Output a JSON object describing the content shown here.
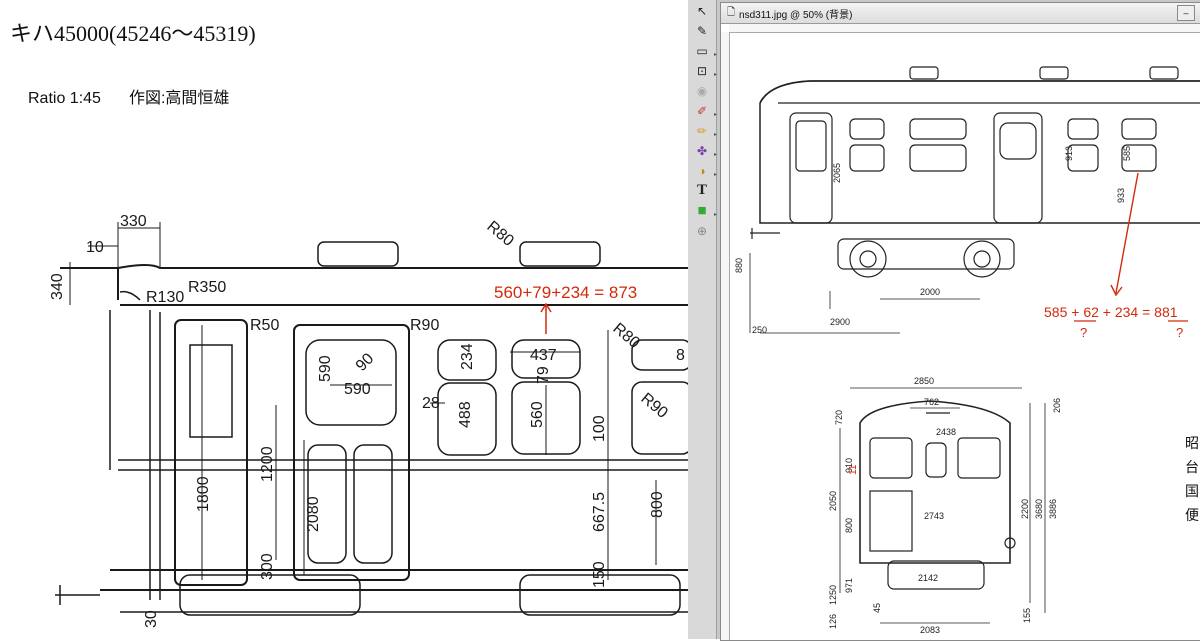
{
  "left_drawing": {
    "title": "キハ45000(45246〜45319)",
    "ratio": "Ratio 1:45",
    "drawn_by": "作図:高間恒雄",
    "dims": {
      "d330": "330",
      "d10": "10",
      "d340": "340",
      "r80": "R80",
      "r130": "R130",
      "r350": "R350",
      "r50": "R50",
      "r90": "R90",
      "r80b": "R80",
      "r90b": "R90",
      "d590a": "590",
      "d590b": "590",
      "d234": "234",
      "d437": "437",
      "d79": "79",
      "d28": "28",
      "d488": "488",
      "d560": "560",
      "d1800": "1800",
      "d1200": "1200",
      "d2080": "2080",
      "d100": "100",
      "d6675": "667.5",
      "d800": "800",
      "d300": "300",
      "d150": "150",
      "d8": "8",
      "d30": "30",
      "d90": "90"
    },
    "annotation": "560+79+234 = 873"
  },
  "app": {
    "window_title": "nsd311.jpg @ 50% (背景)",
    "tools": [
      {
        "icon": "move-tool-icon",
        "glyph": "↖"
      },
      {
        "icon": "eyedropper-icon",
        "glyph": "✎"
      },
      {
        "icon": "marquee-icon",
        "glyph": "▭"
      },
      {
        "icon": "crop-icon",
        "glyph": "⊡"
      },
      {
        "icon": "redeye-icon",
        "glyph": "◉"
      },
      {
        "icon": "brush-icon",
        "glyph": "✐"
      },
      {
        "icon": "pencil-icon",
        "glyph": "✏"
      },
      {
        "icon": "clone-stamp-icon",
        "glyph": "✤"
      },
      {
        "icon": "dodge-icon",
        "glyph": "◑"
      },
      {
        "icon": "text-tool-icon",
        "glyph": "T"
      },
      {
        "icon": "color-swatch-icon",
        "glyph": "■"
      },
      {
        "icon": "zoom-icon",
        "glyph": "⊕"
      }
    ],
    "colors": {
      "accent_red": "#d42a0c",
      "swatch_green": "#33aa33"
    },
    "drawing_dims": {
      "d2065": "2065",
      "d880": "880",
      "d2000": "2000",
      "d2900": "2900",
      "d250": "250",
      "d913": "913",
      "d585": "585",
      "d933": "933",
      "d2850": "2850",
      "d762": "762",
      "d2438": "2438",
      "d2743": "2743",
      "d2142": "2142",
      "d2083": "2083",
      "d3886": "3886",
      "d3680": "3680",
      "d2200": "2200",
      "d2050": "2050",
      "d1250": "1250",
      "d971": "971",
      "d910": "910",
      "d800": "800",
      "d720": "720",
      "d206": "206",
      "d11": "11",
      "d155": "155",
      "d45": "45",
      "d126": "126"
    },
    "annotation_line1": "585 + 62 + 234 = 881",
    "annotation_q1": "?",
    "annotation_q2": "?",
    "side_kanji": [
      "昭",
      "台",
      "国",
      "便"
    ]
  }
}
